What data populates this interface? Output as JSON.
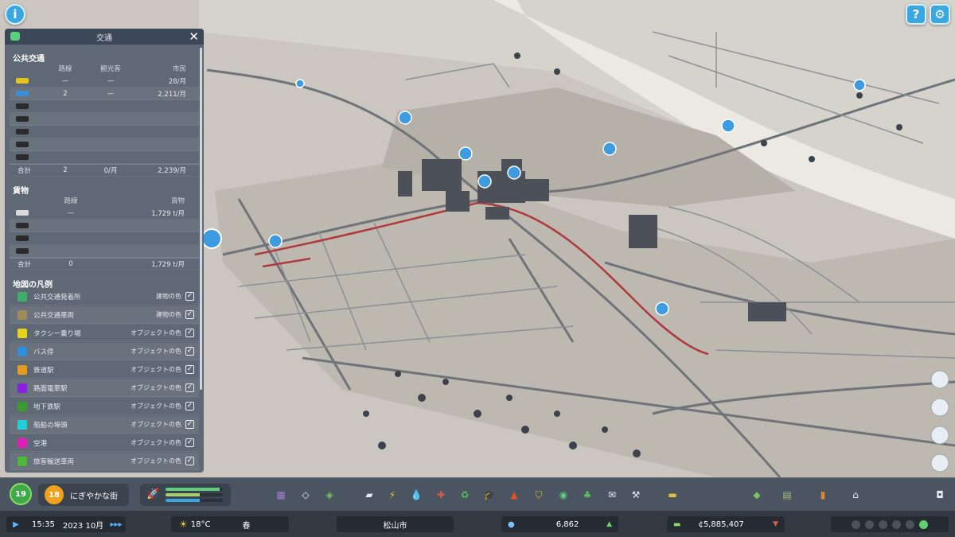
{
  "panel": {
    "title": "交通",
    "close_glyph": "✕",
    "public_transport": {
      "section_title": "公共交通",
      "columns": [
        "路線",
        "観光客",
        "市民"
      ],
      "rows": [
        {
          "icon": "taxi-icon",
          "color": "#e8c21c",
          "lines": "—",
          "tourists": "—",
          "citizens": "28/月"
        },
        {
          "icon": "bus-icon",
          "color": "#3a8fd4",
          "lines": "2",
          "tourists": "—",
          "citizens": "2,211/月"
        },
        {
          "icon": "train-icon",
          "color": "#2a2a2a",
          "lines": "",
          "tourists": "",
          "citizens": ""
        },
        {
          "icon": "tram-icon",
          "color": "#2a2a2a",
          "lines": "",
          "tourists": "",
          "citizens": ""
        },
        {
          "icon": "subway-icon",
          "color": "#2a2a2a",
          "lines": "",
          "tourists": "",
          "citizens": ""
        },
        {
          "icon": "ship-icon",
          "color": "#2a2a2a",
          "lines": "",
          "tourists": "",
          "citizens": ""
        },
        {
          "icon": "airplane-icon",
          "color": "#2a2a2a",
          "lines": "",
          "tourists": "",
          "citizens": ""
        }
      ],
      "total": {
        "label": "合計",
        "lines": "2",
        "tourists": "0/月",
        "citizens": "2,239/月"
      }
    },
    "cargo": {
      "section_title": "貨物",
      "columns": [
        "路線",
        "貨物"
      ],
      "rows": [
        {
          "icon": "cargo-truck-icon",
          "color": "#d9d9d9",
          "lines": "—",
          "cargo": "1,729 t/月"
        },
        {
          "icon": "cargo-train-icon",
          "color": "#2a2a2a",
          "lines": "",
          "cargo": ""
        },
        {
          "icon": "cargo-ship-icon",
          "color": "#2a2a2a",
          "lines": "",
          "cargo": ""
        },
        {
          "icon": "cargo-plane-icon",
          "color": "#2a2a2a",
          "lines": "",
          "cargo": ""
        }
      ],
      "total": {
        "label": "合計",
        "lines": "0",
        "cargo": "1,729 t/月"
      }
    },
    "legend": {
      "section_title": "地図の凡例",
      "items": [
        {
          "label": "公共交通発着所",
          "option": "建物の色",
          "color": "#3fae6a",
          "checked": true
        },
        {
          "label": "公共交通車両",
          "option": "建物の色",
          "color": "#a08a5a",
          "checked": true
        },
        {
          "label": "タクシー乗り場",
          "option": "オブジェクトの色",
          "color": "#e8d21a",
          "checked": true
        },
        {
          "label": "バス停",
          "option": "オブジェクトの色",
          "color": "#2f8fdc",
          "checked": true
        },
        {
          "label": "鉄道駅",
          "option": "オブジェクトの色",
          "color": "#e59a1e",
          "checked": true
        },
        {
          "label": "路面電車駅",
          "option": "オブジェクトの色",
          "color": "#8b1fe0",
          "checked": true
        },
        {
          "label": "地下鉄駅",
          "option": "オブジェクトの色",
          "color": "#3a9b2e",
          "checked": true
        },
        {
          "label": "船舶の埠頭",
          "option": "オブジェクトの色",
          "color": "#1fd0d8",
          "checked": true
        },
        {
          "label": "空港",
          "option": "オブジェクトの色",
          "color": "#e01fb8",
          "checked": true
        },
        {
          "label": "旅客輸送車両",
          "option": "オブジェクトの色",
          "color": "#4db83a",
          "checked": true
        }
      ]
    }
  },
  "toolbar": {
    "level_badge": "19",
    "milestone_badge": "18",
    "milestone_name": "にぎやかな街",
    "progress": {
      "bar1": 0.95,
      "bar2": 0.6,
      "bar3": 0.6
    },
    "tools": [
      "zoning-icon",
      "districts-icon",
      "areas-icon",
      "roads-icon",
      "electricity-icon",
      "water-icon",
      "health-icon",
      "garbage-icon",
      "education-icon",
      "fire-icon",
      "police-icon",
      "transport-icon",
      "parks-icon",
      "communications-icon",
      "landscaping-icon",
      "industry-icon",
      "signature-icon",
      "policy-icon",
      "statistics-icon",
      "disasters-icon",
      "camera-icon"
    ]
  },
  "statusbar": {
    "play_glyph": "▶",
    "time": "15:35",
    "date": "2023 10月",
    "speed_glyph": "▸▸▸",
    "temperature": "18°C",
    "season": "春",
    "city_name": "松山市",
    "population": "6,862",
    "money": "¢5,885,407"
  }
}
